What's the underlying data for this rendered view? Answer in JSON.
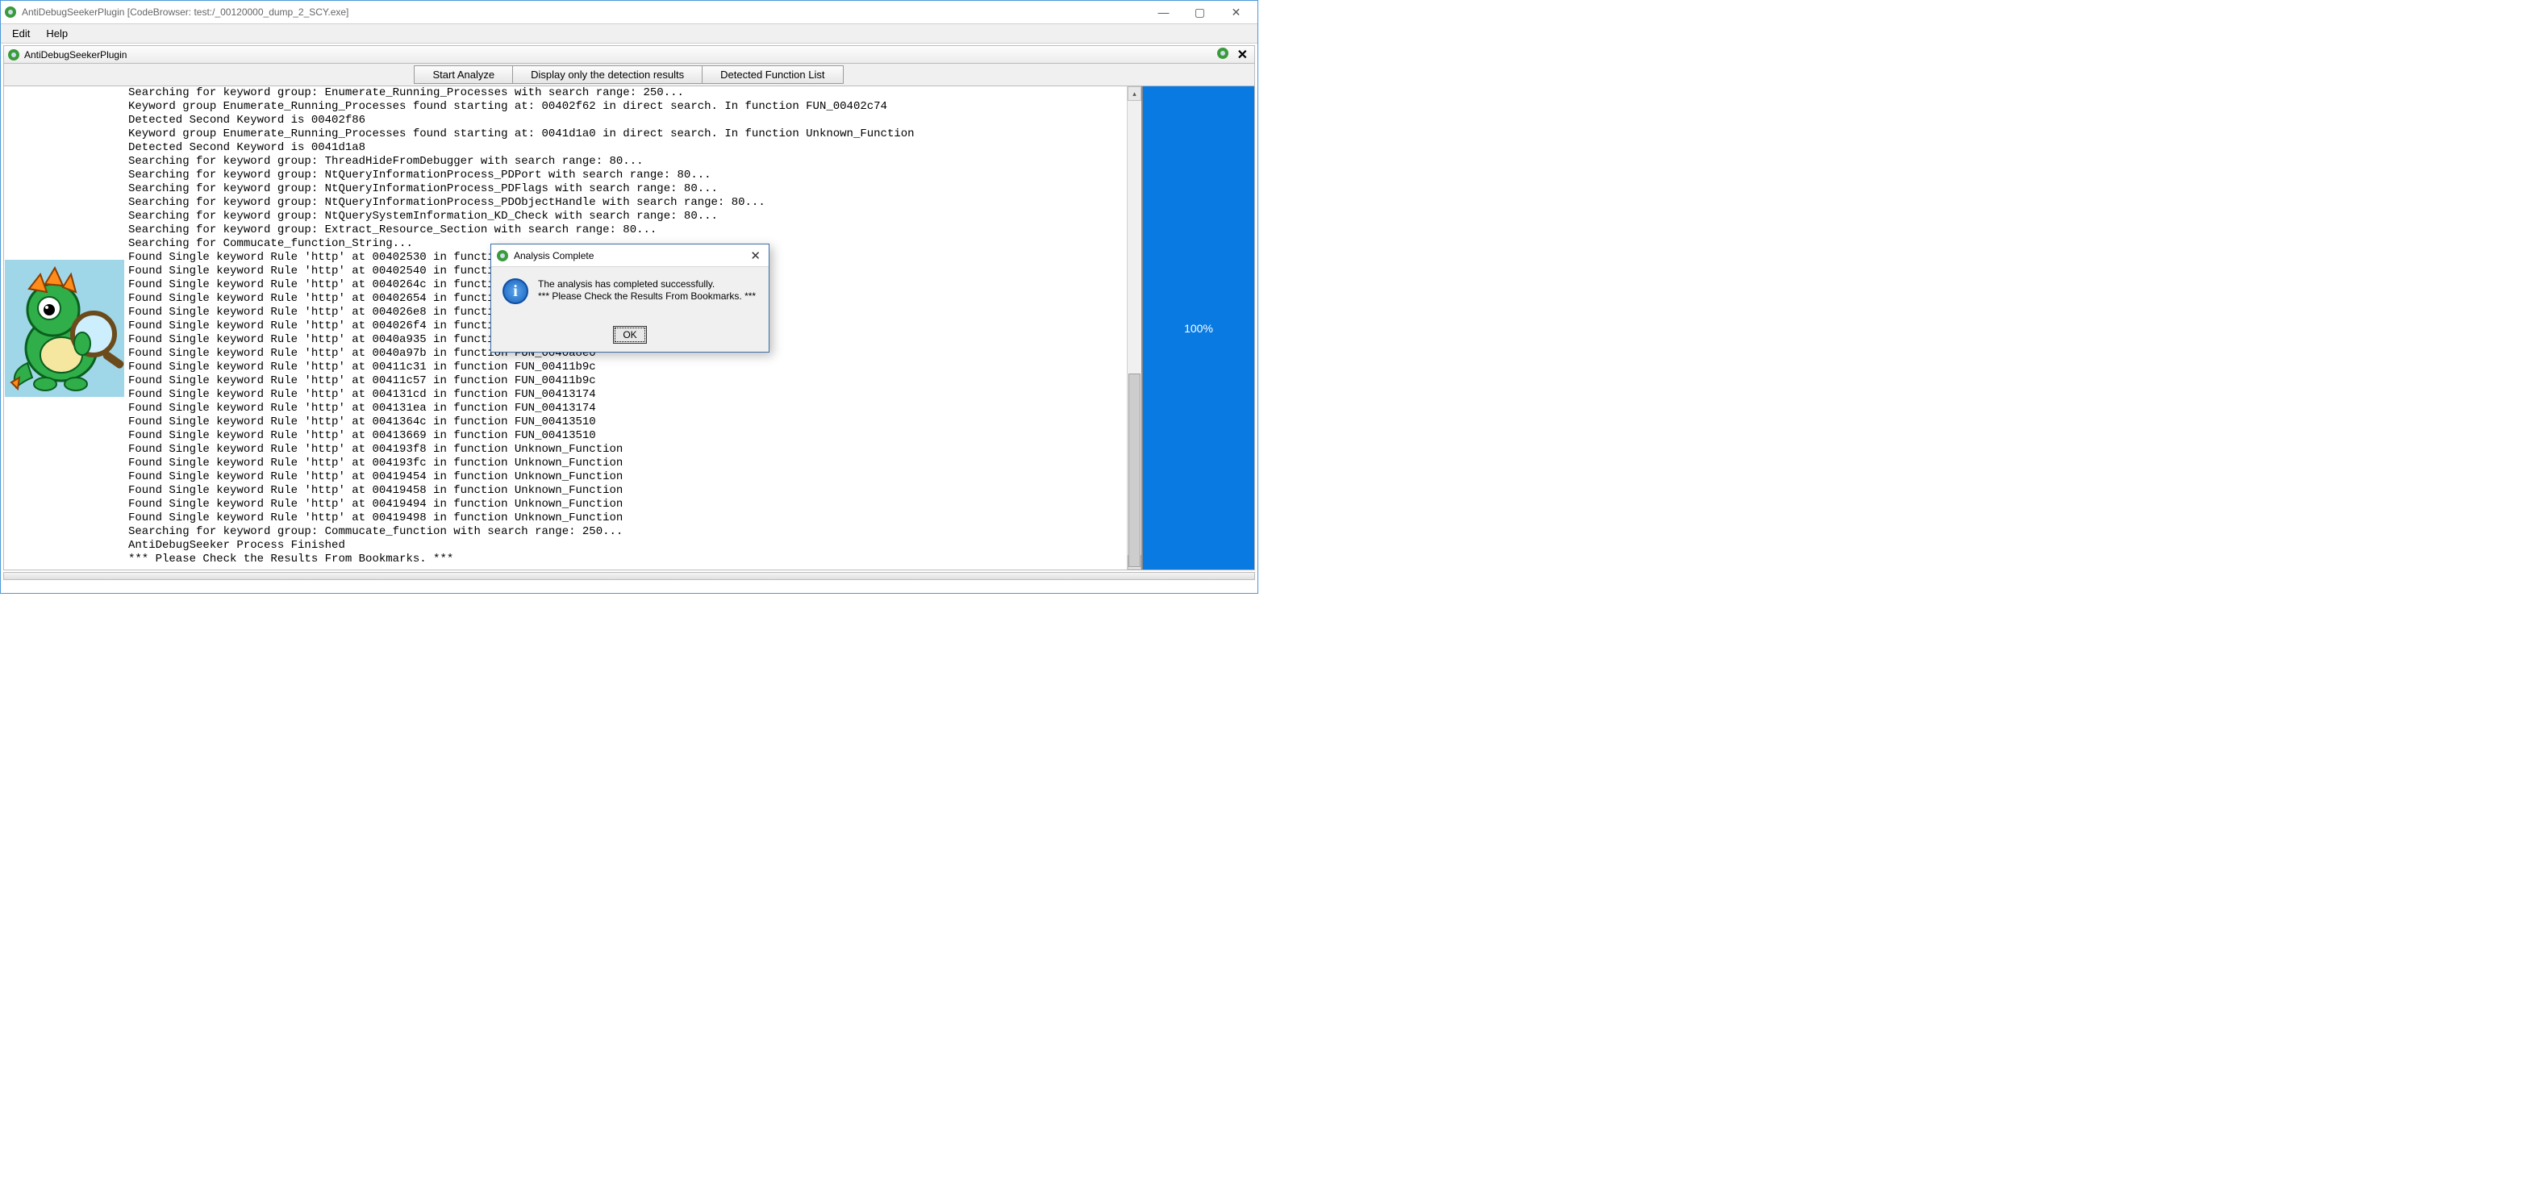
{
  "window": {
    "title": "AntiDebugSeekerPlugin [CodeBrowser: test:/_00120000_dump_2_SCY.exe]"
  },
  "menubar": {
    "edit": "Edit",
    "help": "Help"
  },
  "panel": {
    "title": "AntiDebugSeekerPlugin"
  },
  "toolbar": {
    "start": "Start Analyze",
    "display": "Display only the detection results",
    "detected": "Detected Function List"
  },
  "progress": {
    "label": "100%"
  },
  "dialog": {
    "title": "Analysis Complete",
    "line1": "The analysis has completed successfully.",
    "line2": "*** Please Check the Results From Bookmarks. ***",
    "ok": "OK"
  },
  "console_text": "Searching for keyword group: Enumerate_Running_Processes with search range: 250...\nKeyword group Enumerate_Running_Processes found starting at: 00402f62 in direct search. In function FUN_00402c74\nDetected Second Keyword is 00402f86\nKeyword group Enumerate_Running_Processes found starting at: 0041d1a0 in direct search. In function Unknown_Function\nDetected Second Keyword is 0041d1a8\nSearching for keyword group: ThreadHideFromDebugger with search range: 80...\nSearching for keyword group: NtQueryInformationProcess_PDPort with search range: 80...\nSearching for keyword group: NtQueryInformationProcess_PDFlags with search range: 80...\nSearching for keyword group: NtQueryInformationProcess_PDObjectHandle with search range: 80...\nSearching for keyword group: NtQuerySystemInformation_KD_Check with search range: 80...\nSearching for keyword group: Extract_Resource_Section with search range: 80...\nSearching for Commucate_function_String...\nFound Single keyword Rule 'http' at 00402530 in function Unknown_Function\nFound Single keyword Rule 'http' at 00402540 in function Unknown_Function\nFound Single keyword Rule 'http' at 0040264c in function Unknown_Function\nFound Single keyword Rule 'http' at 00402654 in function Unknown_Function\nFound Single keyword Rule 'http' at 004026e8 in function Unknown_Function\nFound Single keyword Rule 'http' at 004026f4 in function Unknown_Function\nFound Single keyword Rule 'http' at 0040a935 in function FUN_0040a8e0\nFound Single keyword Rule 'http' at 0040a97b in function FUN_0040a8e0\nFound Single keyword Rule 'http' at 00411c31 in function FUN_00411b9c\nFound Single keyword Rule 'http' at 00411c57 in function FUN_00411b9c\nFound Single keyword Rule 'http' at 004131cd in function FUN_00413174\nFound Single keyword Rule 'http' at 004131ea in function FUN_00413174\nFound Single keyword Rule 'http' at 0041364c in function FUN_00413510\nFound Single keyword Rule 'http' at 00413669 in function FUN_00413510\nFound Single keyword Rule 'http' at 004193f8 in function Unknown_Function\nFound Single keyword Rule 'http' at 004193fc in function Unknown_Function\nFound Single keyword Rule 'http' at 00419454 in function Unknown_Function\nFound Single keyword Rule 'http' at 00419458 in function Unknown_Function\nFound Single keyword Rule 'http' at 00419494 in function Unknown_Function\nFound Single keyword Rule 'http' at 00419498 in function Unknown_Function\nSearching for keyword group: Commucate_function with search range: 250...\nAntiDebugSeeker Process Finished\n*** Please Check the Results From Bookmarks. ***"
}
